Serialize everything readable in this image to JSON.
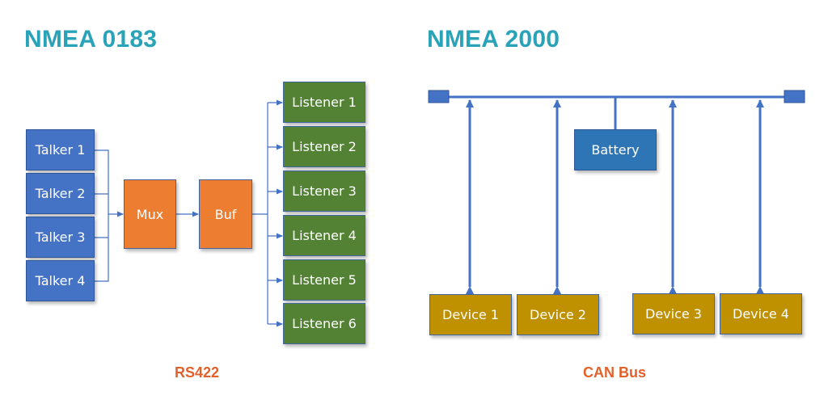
{
  "left": {
    "title": "NMEA 0183",
    "talkers": [
      "Talker 1",
      "Talker 2",
      "Talker 3",
      "Talker 4"
    ],
    "mux": "Mux",
    "buffer": "Buf",
    "listeners": [
      "Listener 1",
      "Listener 2",
      "Listener 3",
      "Listener 4",
      "Listener 5",
      "Listener 6"
    ],
    "footer": "RS422"
  },
  "right": {
    "title": "NMEA 2000",
    "battery": "Battery",
    "devices": [
      "Device 1",
      "Device 2",
      "Device 3",
      "Device 4"
    ],
    "footer": "CAN Bus"
  },
  "colors": {
    "title": "#2aa3b8",
    "footer": "#e2612a",
    "talker": "#4472c4",
    "mux_buf": "#ed7d31",
    "listener": "#548235",
    "battery": "#2e75b6",
    "device": "#bf9000",
    "wire": "#4472c4"
  }
}
